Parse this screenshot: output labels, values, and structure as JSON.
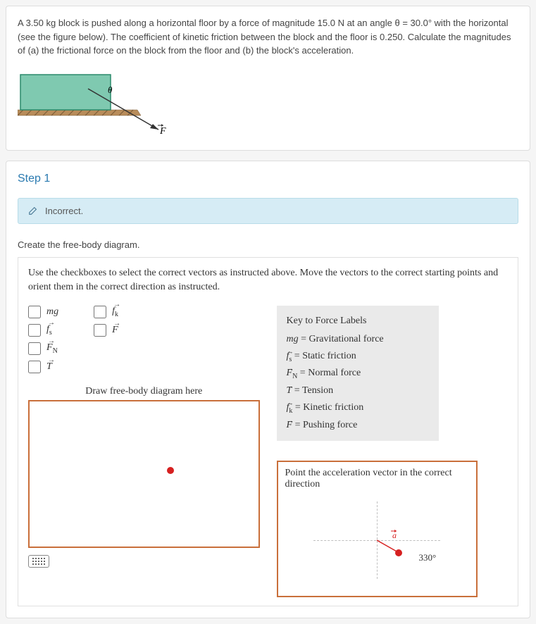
{
  "problem": {
    "text": "A 3.50 kg block is pushed along a horizontal floor by a force of magnitude 15.0 N at an angle θ = 30.0° with the horizontal (see the figure below). The coefficient of kinetic friction between the block and the floor is 0.250. Calculate the magnitudes of (a) the frictional force on the block from the floor and (b) the block's acceleration.",
    "angle_label": "θ",
    "force_label": "F"
  },
  "step": {
    "title": "Step 1",
    "feedback": "Incorrect.",
    "instruction": "Create the free-body diagram.",
    "worksheet_instruction": "Use the checkboxes to select the correct vectors as instructed above. Move the vectors to the correct starting points and orient them in the correct direction as instructed.",
    "checkboxes_col1": [
      {
        "label": "mg"
      },
      {
        "label": "f",
        "sub": "s",
        "vector": true
      },
      {
        "label": "F",
        "sub": "N",
        "vector": true
      },
      {
        "label": "T",
        "vector": true
      }
    ],
    "checkboxes_col2": [
      {
        "label": "f",
        "sub": "k",
        "vector": true
      },
      {
        "label": "F",
        "vector": true
      }
    ],
    "draw_label": "Draw free-body diagram here",
    "key": {
      "title": "Key to Force Labels",
      "rows": [
        {
          "sym": "mg",
          "desc": "Gravitational force"
        },
        {
          "sym": "f",
          "sub": "s",
          "vector": true,
          "desc": "Static friction"
        },
        {
          "sym": "F",
          "sub": "N",
          "vector": true,
          "desc": "Normal force"
        },
        {
          "sym": "T",
          "vector": true,
          "desc": "Tension"
        },
        {
          "sym": "f",
          "sub": "k",
          "vector": true,
          "desc": "Kinetic friction"
        },
        {
          "sym": "F",
          "vector": true,
          "desc": "Pushing force"
        }
      ]
    },
    "accel": {
      "instruction": "Point the acceleration vector in the correct direction",
      "vector_label": "a",
      "angle": "330°"
    }
  }
}
